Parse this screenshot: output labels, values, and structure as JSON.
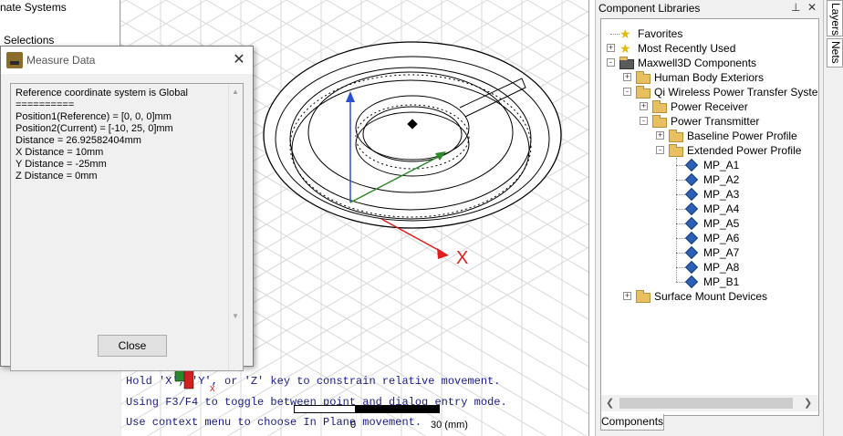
{
  "left_panel": {
    "row1": "nate Systems",
    "row2": "Selections"
  },
  "dialog": {
    "title": "Measure Data",
    "lines": [
      "Reference coordinate system is Global",
      "==========",
      "Position1(Reference) = [0, 0, 0]mm",
      "Position2(Current) = [-10, 25, 0]mm",
      "Distance = 26.92582404mm",
      "X Distance = 10mm",
      "Y Distance = -25mm",
      "Z Distance = 0mm"
    ],
    "close_label": "Close"
  },
  "viewport": {
    "axis_x_label": "X",
    "mini_axis_label": "x",
    "hints": [
      "Hold 'X', 'Y', or 'Z' key to constrain relative movement.",
      "Using F3/F4 to toggle between point and dialog entry mode.",
      "Use context menu to choose In Plane movement."
    ],
    "ruler_zero": "0",
    "ruler_label": "30 (mm)",
    "colors": {
      "x_axis": "#e02020",
      "y_axis": "#2a8a2a",
      "z_axis": "#2a4fd0"
    }
  },
  "libraries": {
    "title": "Component Libraries",
    "pin": "ⱼ",
    "close": "✕",
    "tree": [
      {
        "label": "Favorites",
        "level": 0,
        "kind": "star",
        "expander": ""
      },
      {
        "label": "Most Recently Used",
        "level": 0,
        "kind": "star",
        "expander": "+"
      },
      {
        "label": "Maxwell3D Components",
        "level": 0,
        "kind": "app",
        "expander": "-"
      },
      {
        "label": "Human Body Exteriors",
        "level": 1,
        "kind": "folder",
        "expander": "+"
      },
      {
        "label": "Qi Wireless Power Transfer System",
        "level": 1,
        "kind": "folder",
        "expander": "-"
      },
      {
        "label": "Power Receiver",
        "level": 2,
        "kind": "folder",
        "expander": "+"
      },
      {
        "label": "Power Transmitter",
        "level": 2,
        "kind": "folder",
        "expander": "-"
      },
      {
        "label": "Baseline Power Profile",
        "level": 3,
        "kind": "folder",
        "expander": "+"
      },
      {
        "label": "Extended Power Profile",
        "level": 3,
        "kind": "folder",
        "expander": "-"
      },
      {
        "label": "MP_A1",
        "level": 4,
        "kind": "comp",
        "expander": ""
      },
      {
        "label": "MP_A2",
        "level": 4,
        "kind": "comp",
        "expander": ""
      },
      {
        "label": "MP_A3",
        "level": 4,
        "kind": "comp",
        "expander": ""
      },
      {
        "label": "MP_A4",
        "level": 4,
        "kind": "comp",
        "expander": ""
      },
      {
        "label": "MP_A5",
        "level": 4,
        "kind": "comp",
        "expander": ""
      },
      {
        "label": "MP_A6",
        "level": 4,
        "kind": "comp",
        "expander": ""
      },
      {
        "label": "MP_A7",
        "level": 4,
        "kind": "comp",
        "expander": ""
      },
      {
        "label": "MP_A8",
        "level": 4,
        "kind": "comp",
        "expander": ""
      },
      {
        "label": "MP_B1",
        "level": 4,
        "kind": "comp",
        "expander": ""
      },
      {
        "label": "Surface Mount Devices",
        "level": 1,
        "kind": "folder",
        "expander": "+"
      }
    ],
    "tab_label": "Components"
  },
  "side_tabs": [
    "Layers",
    "Nets"
  ]
}
